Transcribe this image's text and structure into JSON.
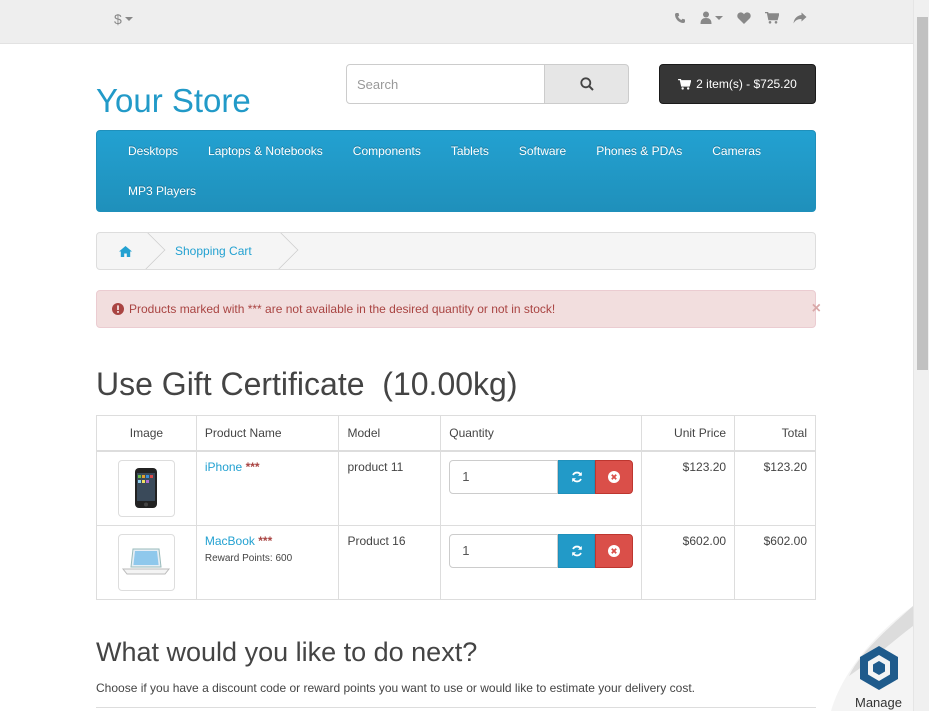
{
  "topbar": {
    "currency_symbol": "$",
    "icons": [
      "phone-icon",
      "user-icon",
      "heart-icon",
      "cart-icon",
      "share-icon"
    ]
  },
  "header": {
    "logo": "Your Store",
    "search_placeholder": "Search",
    "search_icon": "search-icon",
    "cart_button": "2 item(s) - $725.20"
  },
  "menu": {
    "items": [
      "Desktops",
      "Laptops & Notebooks",
      "Components",
      "Tablets",
      "Software",
      "Phones & PDAs",
      "Cameras",
      "MP3 Players"
    ]
  },
  "breadcrumb": {
    "home_icon": "home-icon",
    "current": "Shopping Cart"
  },
  "alert": {
    "text": "Products marked with *** are not available in the desired quantity or not in stock!",
    "close": "×",
    "color": "#a94442"
  },
  "page": {
    "title": "Use Gift Certificate  (10.00kg)"
  },
  "table": {
    "headers": {
      "image": "Image",
      "name": "Product Name",
      "model": "Model",
      "quantity": "Quantity",
      "unit_price": "Unit Price",
      "total": "Total"
    },
    "rows": [
      {
        "name": "iPhone",
        "stock_flag": "***",
        "reward": "",
        "model": "product 11",
        "quantity": "1",
        "unit_price": "$123.20",
        "total": "$123.20"
      },
      {
        "name": "MacBook",
        "stock_flag": "***",
        "reward": "Reward Points: 600",
        "model": "Product 16",
        "quantity": "1",
        "unit_price": "$602.00",
        "total": "$602.00"
      }
    ]
  },
  "next": {
    "heading": "What would you like to do next?",
    "text": "Choose if you have a discount code or reward points you want to use or would like to estimate your delivery cost."
  },
  "overlay": {
    "label": "Manage"
  },
  "colors": {
    "accent": "#229ac8",
    "danger": "#da4f49",
    "dark_button": "#363636"
  }
}
